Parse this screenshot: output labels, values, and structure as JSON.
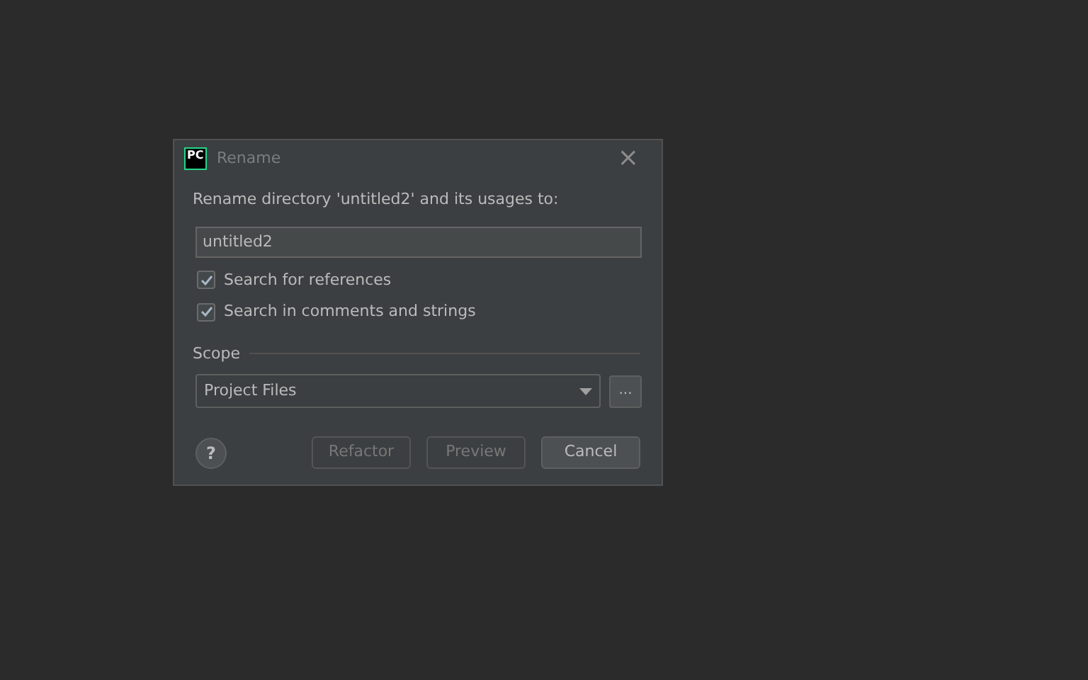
{
  "window": {
    "logo": "PC",
    "title": "Rename",
    "close": "×"
  },
  "prompt": "Rename directory 'untitled2' and its usages to:",
  "name_field": {
    "value": "untitled2"
  },
  "options": [
    {
      "label": "Search for references",
      "checked": true
    },
    {
      "label": "Search in comments and strings",
      "checked": true
    }
  ],
  "scope": {
    "heading": "Scope",
    "value": "Project Files",
    "more": "..."
  },
  "help": "?",
  "buttons": [
    {
      "label": "Refactor",
      "disabled": true
    },
    {
      "label": "Preview",
      "disabled": true
    },
    {
      "label": "Cancel",
      "disabled": false
    }
  ]
}
